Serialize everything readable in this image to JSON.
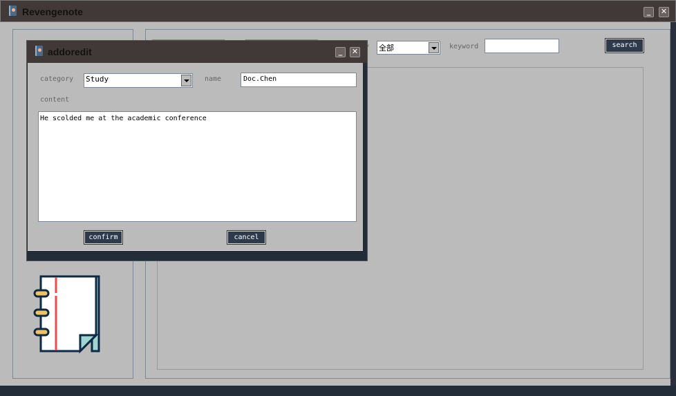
{
  "main_window": {
    "title": "Revengenote",
    "icon": "notebook-icon",
    "minimize_icon": "minimize-icon",
    "close_icon": "close-icon"
  },
  "search_bar": {
    "category_label_partial": "ry",
    "category_value": "全部",
    "keyword_label": "keyword",
    "keyword_value": "",
    "search_label": "search"
  },
  "dialog": {
    "title": "addoredit",
    "category_label": "category",
    "category_value": "Study",
    "name_label": "name",
    "name_value": "Doc.Chen",
    "content_label": "content",
    "content_value": "He scolded me at the academic conference",
    "confirm_label": "confirm",
    "cancel_label": "cancel"
  },
  "colors": {
    "titlebar": "#413937",
    "background": "#bbbbbb",
    "button": "#2e3a4c",
    "bottom_bar": "#232c39"
  }
}
